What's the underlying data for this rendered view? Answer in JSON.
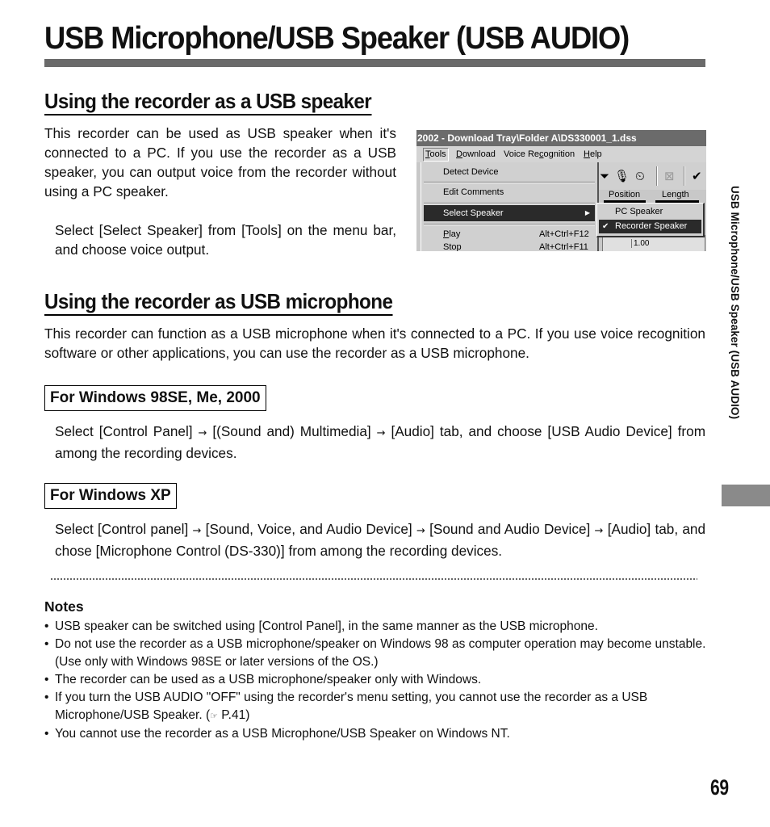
{
  "page": {
    "title": "USB Microphone/USB Speaker (USB AUDIO)",
    "side_label": "USB Microphone/USB Speaker (USB AUDIO)",
    "page_number": "69"
  },
  "speaker_section": {
    "heading": "Using the recorder as a USB speaker",
    "intro": "This recorder can be used as USB speaker when it's connected to a PC. If you use the recorder as a USB speaker, you can output voice from the recorder without using a PC speaker.",
    "step": "Select [Select Speaker] from [Tools] on the menu bar, and choose voice output."
  },
  "screenshot": {
    "window_title": "2002 - Download Tray\\Folder A\\DS330001_1.dss",
    "menubar": [
      {
        "label": "Tools",
        "underline": "T",
        "rest": "ools"
      },
      {
        "label": "Download",
        "underline": "D",
        "rest": "ownload"
      },
      {
        "label": "Voice Recognition",
        "pre": "Voice Re",
        "underline": "c",
        "rest": "ognition"
      },
      {
        "label": "Help",
        "underline": "H",
        "rest": "elp"
      }
    ],
    "tools_menu": [
      {
        "label": "Detect Device",
        "shortcut": ""
      },
      {
        "label": "Edit Comments",
        "shortcut": ""
      },
      {
        "label": "Select Speaker",
        "shortcut": "",
        "submenu": true,
        "selected": true
      },
      {
        "label": "Play",
        "underline": "P",
        "rest": "lay",
        "shortcut": "Alt+Ctrl+F12"
      },
      {
        "label": "Stop",
        "shortcut": "Alt+Ctrl+F11"
      }
    ],
    "speaker_submenu": [
      {
        "label": "PC Speaker",
        "checked": false
      },
      {
        "label": "Recorder Speaker",
        "checked": true
      }
    ],
    "toolbar_icons": [
      "filter-icon",
      "microphone-icon",
      "timer-icon",
      "voice-recognition-icon",
      "checkmark-icon"
    ],
    "position_label": "Position",
    "length_label": "Length",
    "ruler_value": "1.00"
  },
  "mic_section": {
    "heading": "Using the recorder as USB microphone",
    "intro": "This recorder can function as a USB microphone when it's connected to a PC. If you use voice recognition software or other applications, you can use the recorder as a USB microphone.",
    "win98": {
      "heading": "For Windows 98SE, Me, 2000",
      "steps": [
        "Select [Control Panel]",
        "[(Sound and) Multimedia]",
        "[Audio] tab, and choose [USB Audio Device] from among the recording devices."
      ]
    },
    "winxp": {
      "heading": "For Windows XP",
      "steps": [
        "Select [Control panel]",
        "[Sound, Voice, and Audio Device]",
        "[Sound and Audio Device]",
        "[Audio] tab, and chose [Microphone Control (DS-330)] from among the recording devices."
      ]
    },
    "arrow": "→"
  },
  "notes": {
    "title": "Notes",
    "bullet": "•",
    "items": [
      "USB speaker can be switched using [Control Panel], in the same manner as the USB microphone.",
      "Do not use the recorder as a USB microphone/speaker on Windows 98 as computer operation may become unstable. (Use only with Windows 98SE or later versions of the OS.)",
      "The recorder can be used as a USB microphone/speaker only with Windows.",
      "If you turn the USB AUDIO \"OFF\" using the recorder's menu setting, you cannot use the recorder as a USB Microphone/USB Speaker. (",
      "You cannot use the recorder as a USB Microphone/USB Speaker on Windows NT."
    ],
    "ref_icon": "☞",
    "ref_page": " P.41)"
  }
}
